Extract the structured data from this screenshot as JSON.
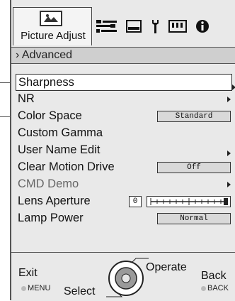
{
  "tabs": {
    "active_label": "Picture Adjust",
    "icons": [
      "picture-icon",
      "sliders-icon",
      "display-icon",
      "installation-icon",
      "memory-card-icon",
      "info-icon"
    ]
  },
  "header": {
    "breadcrumb": "› Advanced"
  },
  "menu": {
    "items": [
      {
        "label": "Sharpness",
        "selected": true,
        "submenu": true
      },
      {
        "label": "NR",
        "submenu": true
      },
      {
        "label": "Color Space",
        "value": "Standard"
      },
      {
        "label": "Custom Gamma"
      },
      {
        "label": "User Name Edit",
        "submenu": true
      },
      {
        "label": "Clear Motion Drive",
        "value": "Off"
      },
      {
        "label": "CMD Demo",
        "submenu": true,
        "disabled": true
      },
      {
        "label": "Lens Aperture",
        "number": "0",
        "slider_level": 1.0
      },
      {
        "label": "Lamp Power",
        "value": "Normal"
      }
    ]
  },
  "footer": {
    "exit_label": "Exit",
    "exit_key": "MENU",
    "select_label": "Select",
    "operate_label": "Operate",
    "back_label": "Back",
    "back_key": "BACK"
  }
}
